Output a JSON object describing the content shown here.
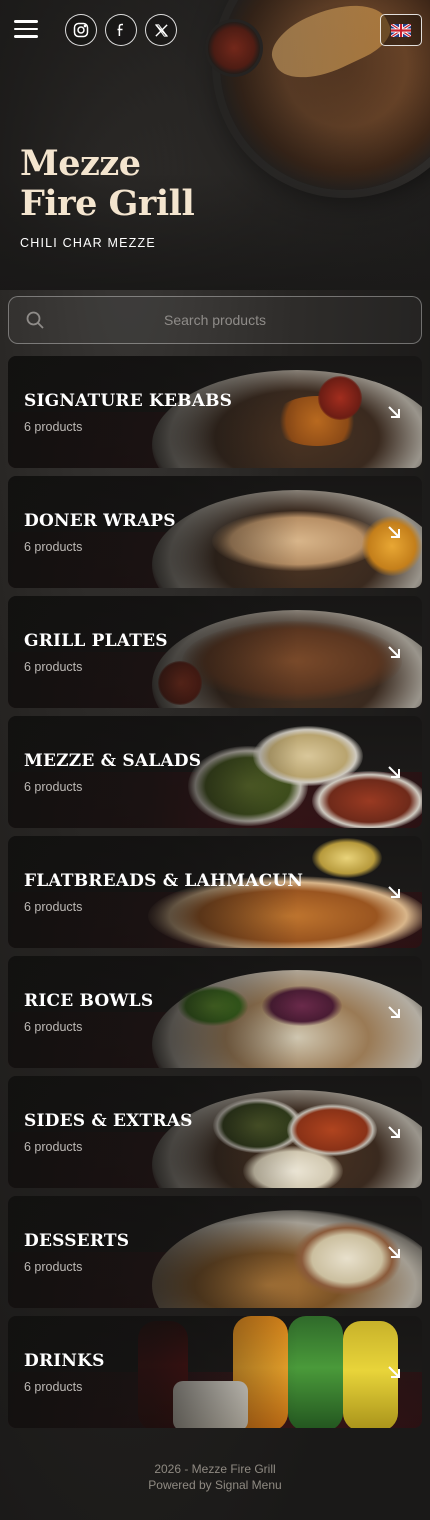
{
  "header": {
    "brand_line1": "Mezze",
    "brand_line2": "Fire Grill",
    "tagline": "CHILI CHAR MEZZE",
    "language": "English",
    "social": [
      "instagram-icon",
      "facebook-icon",
      "x-twitter-icon"
    ]
  },
  "search": {
    "placeholder": "Search products"
  },
  "categories": [
    {
      "name": "SIGNATURE KEBABS",
      "count": "6 products"
    },
    {
      "name": "DONER WRAPS",
      "count": "6 products"
    },
    {
      "name": "GRILL PLATES",
      "count": "6 products"
    },
    {
      "name": "MEZZE & SALADS",
      "count": "6 products"
    },
    {
      "name": "FLATBREADS & LAHMACUN",
      "count": "6 products"
    },
    {
      "name": "RICE BOWLS",
      "count": "6 products"
    },
    {
      "name": "SIDES & EXTRAS",
      "count": "6 products"
    },
    {
      "name": "DESSERTS",
      "count": "6 products"
    },
    {
      "name": "DRINKS",
      "count": "6 products"
    }
  ],
  "footer": {
    "copyright": "2026 - Mezze Fire Grill",
    "powered": "Powered by Signal Menu"
  },
  "colors": {
    "background": "#1b1a19",
    "brand_text": "#f4e5cf",
    "card_accent": "#3a1418"
  }
}
